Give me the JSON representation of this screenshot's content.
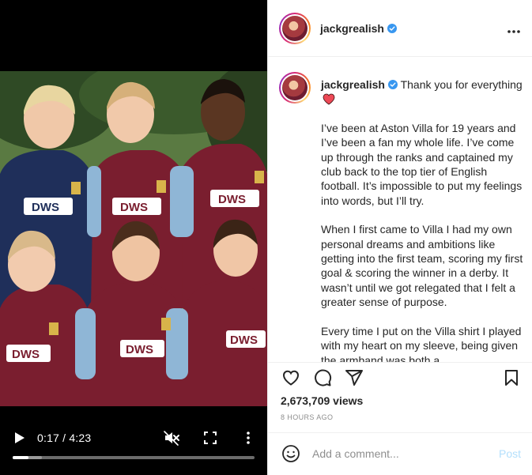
{
  "video": {
    "time_display": "0:17 / 4:23",
    "progress_fraction": 0.065,
    "buffered_fraction": 0.12,
    "icons": {
      "play": "play-icon",
      "mute": "muted-speaker-icon",
      "fullscreen": "fullscreen-icon",
      "more": "more-vertical-icon"
    }
  },
  "header": {
    "username": "jackgrealish",
    "verified": true,
    "more_icon": "more-horizontal-icon"
  },
  "caption": {
    "username": "jackgrealish",
    "first_line": "Thank you for everything",
    "emoji": "red-heart",
    "paragraphs": [
      "I’ve been at Aston Villa for 19 years and I’ve been a fan my whole life. I’ve come up through the ranks and captained my club back to the top tier of English football. It’s impossible to put my feelings into words, but I’ll try.",
      "When I first came to Villa I had my own personal dreams and ambitions like getting into the first team, scoring my first goal & scoring the winner in a derby. It wasn’t until we got relegated that I felt a greater sense of purpose.",
      "Every time I put on the Villa shirt I played with my heart on my sleeve, being given the armband was both a"
    ]
  },
  "actions": {
    "icons": [
      "heart-icon",
      "comment-icon",
      "share-icon",
      "bookmark-icon"
    ]
  },
  "stats": {
    "views": "2,673,709 views",
    "time_ago": "8 HOURS AGO"
  },
  "comment": {
    "placeholder": "Add a comment...",
    "post_label": "Post",
    "emoji_icon": "smiley-icon"
  },
  "colors": {
    "verified_blue": "#3897f0",
    "heart_red": "#ed4956",
    "post_disabled": "#b2dffc",
    "meta_gray": "#8e8e8e"
  }
}
